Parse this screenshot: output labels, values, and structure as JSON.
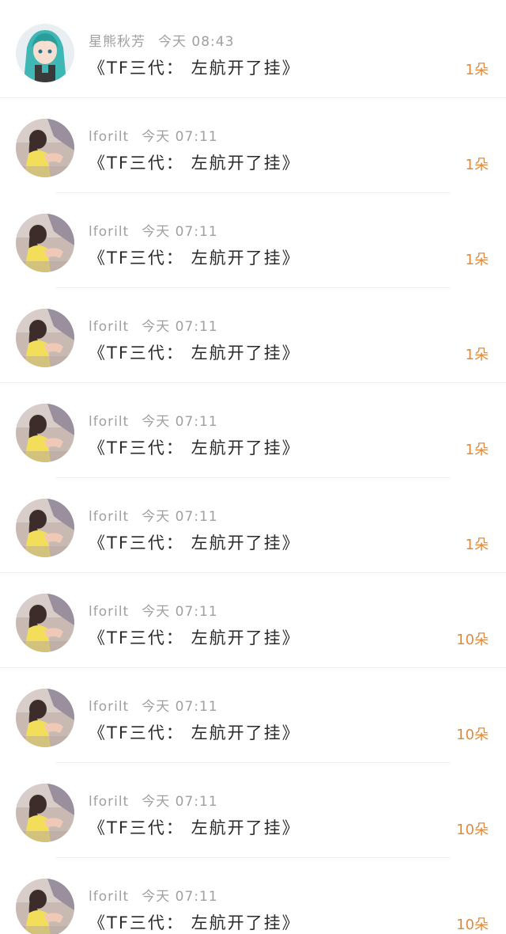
{
  "messages": [
    {
      "user": "星熊秋芳",
      "time": "今天 08:43",
      "title": "《TF三代： 左航开了挂》",
      "count": "1朵",
      "avatar": "miku-avatar"
    },
    {
      "user": "lforilt",
      "time": "今天 07:11",
      "title": "《TF三代： 左航开了挂》",
      "count": "1朵",
      "avatar": "girl-photo-avatar"
    },
    {
      "user": "lforilt",
      "time": "今天 07:11",
      "title": "《TF三代： 左航开了挂》",
      "count": "1朵",
      "avatar": "girl-photo-avatar"
    },
    {
      "user": "lforilt",
      "time": "今天 07:11",
      "title": "《TF三代： 左航开了挂》",
      "count": "1朵",
      "avatar": "girl-photo-avatar"
    },
    {
      "user": "lforilt",
      "time": "今天 07:11",
      "title": "《TF三代： 左航开了挂》",
      "count": "1朵",
      "avatar": "girl-photo-avatar"
    },
    {
      "user": "lforilt",
      "time": "今天 07:11",
      "title": "《TF三代： 左航开了挂》",
      "count": "1朵",
      "avatar": "girl-photo-avatar"
    },
    {
      "user": "lforilt",
      "time": "今天 07:11",
      "title": "《TF三代： 左航开了挂》",
      "count": "10朵",
      "avatar": "girl-photo-avatar"
    },
    {
      "user": "lforilt",
      "time": "今天 07:11",
      "title": "《TF三代： 左航开了挂》",
      "count": "10朵",
      "avatar": "girl-photo-avatar"
    },
    {
      "user": "lforilt",
      "time": "今天 07:11",
      "title": "《TF三代： 左航开了挂》",
      "count": "10朵",
      "avatar": "girl-photo-avatar"
    },
    {
      "user": "lforilt",
      "time": "今天 07:11",
      "title": "《TF三代： 左航开了挂》",
      "count": "10朵",
      "avatar": "girl-photo-avatar"
    }
  ],
  "colors": {
    "count": "#e08a3c",
    "meta": "#a0a0a0",
    "title": "#2a2a2a",
    "divider": "#f0f0f0"
  }
}
